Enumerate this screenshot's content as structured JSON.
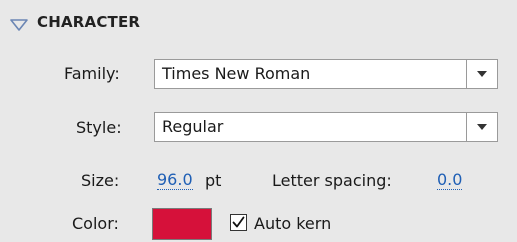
{
  "panel": {
    "title": "CHARACTER",
    "collapse_icon": "triangle-down-icon"
  },
  "family": {
    "label": "Family:",
    "value": "Times New Roman",
    "arrow_icon": "dropdown-arrow-icon"
  },
  "style": {
    "label": "Style:",
    "value": "Regular",
    "arrow_icon": "dropdown-arrow-icon"
  },
  "size": {
    "label": "Size:",
    "value": "96.0",
    "unit": "pt"
  },
  "letter_spacing": {
    "label": "Letter spacing:",
    "value": "0.0"
  },
  "color": {
    "label": "Color:",
    "swatch": "#d6113a"
  },
  "auto_kern": {
    "label": "Auto kern",
    "checked": true
  },
  "colors": {
    "background": "#e8e8e8",
    "link": "#1f5fb5",
    "collapse_icon": "#6b86b4"
  }
}
